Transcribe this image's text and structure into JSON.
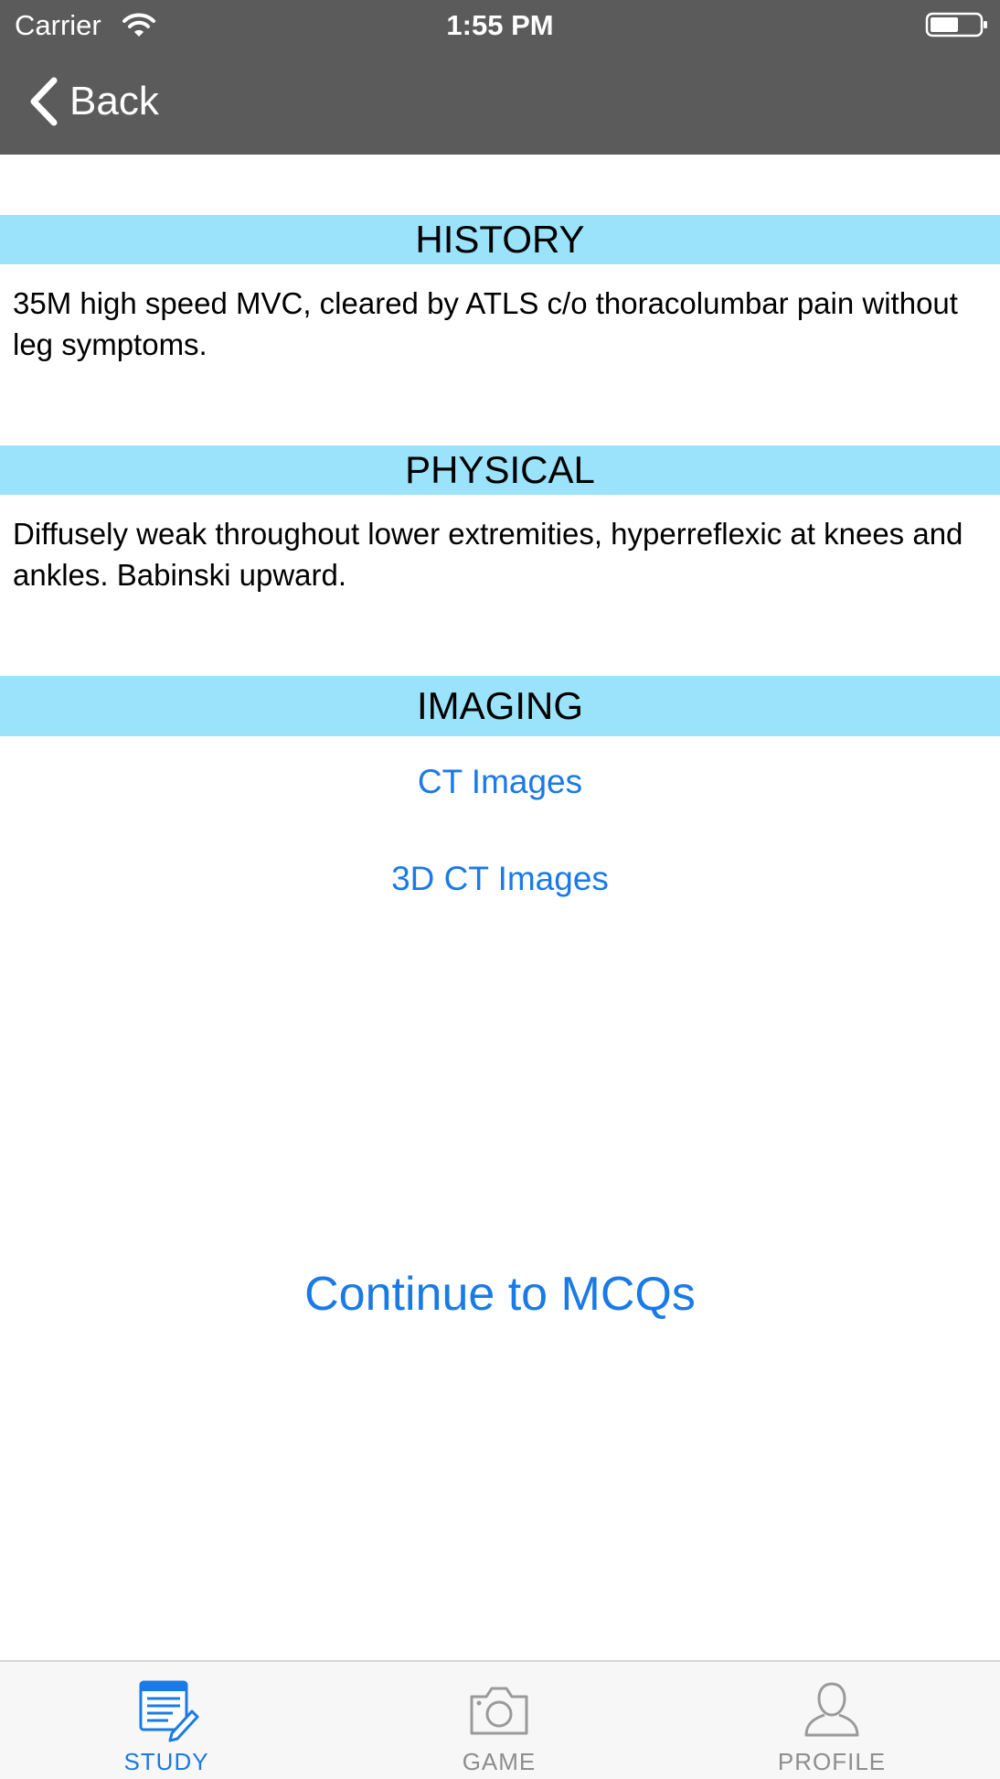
{
  "status_bar": {
    "carrier": "Carrier",
    "time": "1:55 PM",
    "icons": [
      "wifi-icon",
      "battery-icon"
    ]
  },
  "nav": {
    "back_label": "Back",
    "back_icon": "chevron-left-icon"
  },
  "sections": {
    "history": {
      "title": "HISTORY",
      "text": "35M high speed MVC, cleared by ATLS c/o thoracolumbar pain without leg symptoms."
    },
    "physical": {
      "title": "PHYSICAL",
      "text": "Diffusely weak throughout lower extremities, hyperreflexic at knees and ankles. Babinski upward."
    },
    "imaging": {
      "title": "IMAGING",
      "links": [
        "CT Images",
        "3D CT Images"
      ]
    }
  },
  "continue_label": "Continue to MCQs",
  "tabs": [
    {
      "label": "STUDY",
      "icon": "study-document-icon",
      "selected": true
    },
    {
      "label": "GAME",
      "icon": "camera-icon",
      "selected": false
    },
    {
      "label": "PROFILE",
      "icon": "person-icon",
      "selected": false
    }
  ],
  "colors": {
    "bar_background": "#5b5b5b",
    "section_header": "#9be3fb",
    "link_blue": "#1a7ae6",
    "tab_inactive": "#8e8e8e"
  }
}
